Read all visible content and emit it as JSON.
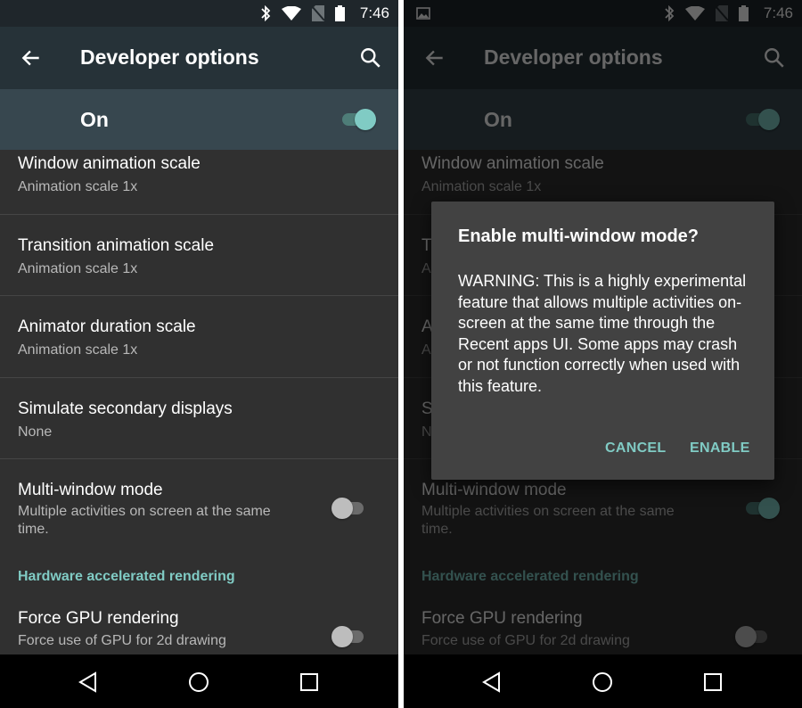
{
  "status_bar": {
    "time": "7:46",
    "icons": [
      "bluetooth-icon",
      "wifi-icon",
      "no-sim-icon",
      "battery-icon"
    ],
    "notification_icons_right_screen": [
      "image-notification-icon"
    ]
  },
  "app_bar": {
    "title": "Developer options",
    "back_icon": "arrow-back-icon",
    "search_icon": "search-icon"
  },
  "master_switch": {
    "label": "On",
    "state": true
  },
  "preferences": [
    {
      "title": "Window animation scale",
      "summary": "Animation scale 1x"
    },
    {
      "title": "Transition animation scale",
      "summary": "Animation scale 1x"
    },
    {
      "title": "Animator duration scale",
      "summary": "Animation scale 1x"
    },
    {
      "title": "Simulate secondary displays",
      "summary": "None"
    },
    {
      "title": "Multi-window mode",
      "summary": "Multiple activities on screen at the same time.",
      "switch_left": false,
      "switch_right": true
    }
  ],
  "category": {
    "label": "Hardware accelerated rendering"
  },
  "force_gpu": {
    "title": "Force GPU rendering",
    "summary": "Force use of GPU for 2d drawing",
    "state": false
  },
  "dialog": {
    "title": "Enable multi-window mode?",
    "message": "WARNING: This is a highly experimental feature that allows multiple activities on-screen at the same time through the Recent apps UI. Some apps may crash or not function correctly when used with this feature.",
    "cancel_label": "CANCEL",
    "enable_label": "ENABLE"
  },
  "nav_bar": {
    "buttons": [
      "back-nav-icon",
      "home-nav-icon",
      "recents-nav-icon"
    ]
  },
  "colors": {
    "accent": "#80cbc4",
    "app_bar": "#263238",
    "master_bar": "#37474f",
    "background": "#303030",
    "dialog": "#424242"
  }
}
